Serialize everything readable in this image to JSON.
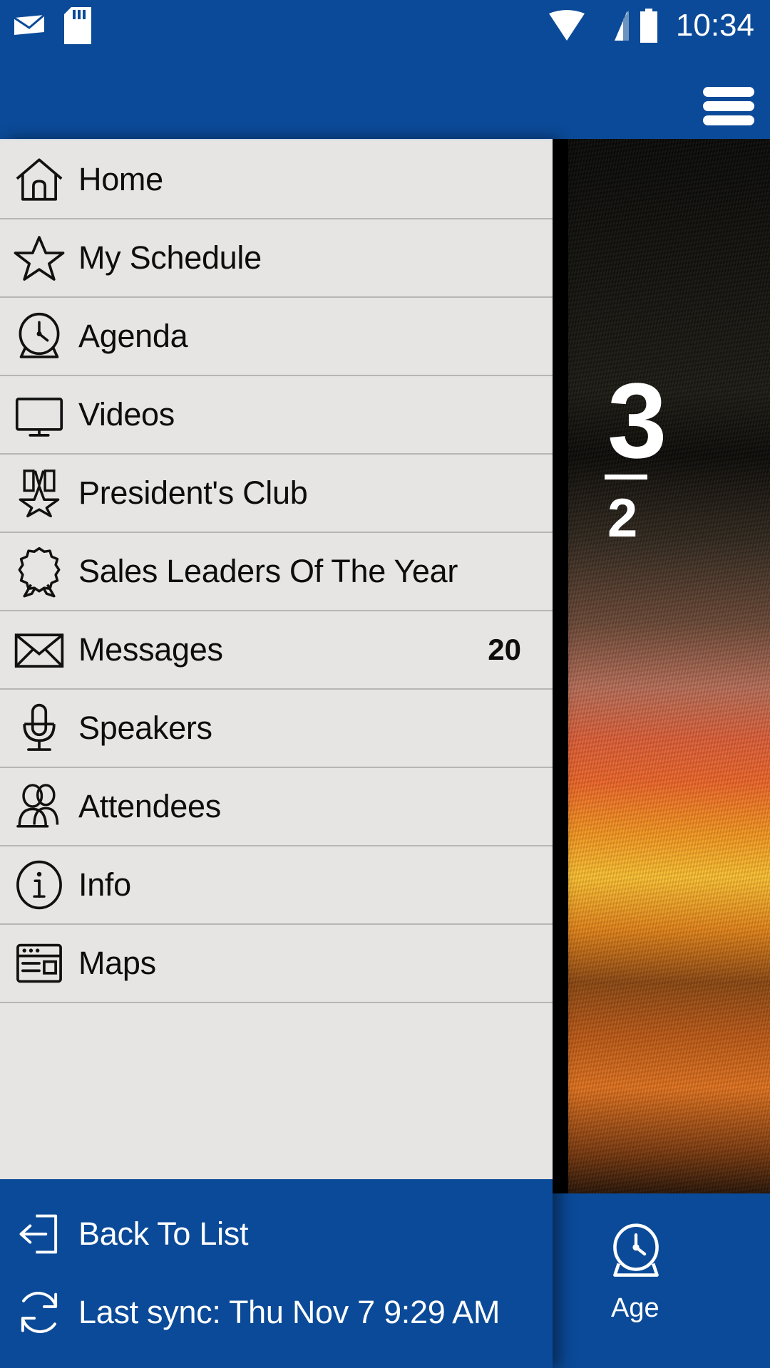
{
  "status_bar": {
    "time": "10:34",
    "icons": [
      "mail-icon",
      "sd-card-icon",
      "wifi-icon",
      "cellular-signal-icon",
      "battery-icon"
    ]
  },
  "app_bar": {
    "menu_icon": "hamburger-menu-icon",
    "background_color": "#0b4a98"
  },
  "background_content": {
    "hero_line_1": "3",
    "hero_line_2": "2",
    "tab_bar": [
      {
        "icon": "clock-icon",
        "label": "Age"
      }
    ]
  },
  "drawer": {
    "background_color": "#e6e5e3",
    "items": [
      {
        "icon": "home-icon",
        "label": "Home",
        "badge": ""
      },
      {
        "icon": "star-icon",
        "label": "My Schedule",
        "badge": ""
      },
      {
        "icon": "clock-icon",
        "label": "Agenda",
        "badge": ""
      },
      {
        "icon": "monitor-icon",
        "label": "Videos",
        "badge": ""
      },
      {
        "icon": "medal-icon",
        "label": "President's Club",
        "badge": ""
      },
      {
        "icon": "award-ribbon-icon",
        "label": "Sales Leaders Of The Year",
        "badge": ""
      },
      {
        "icon": "envelope-icon",
        "label": "Messages",
        "badge": "20"
      },
      {
        "icon": "microphone-icon",
        "label": "Speakers",
        "badge": ""
      },
      {
        "icon": "people-icon",
        "label": "Attendees",
        "badge": ""
      },
      {
        "icon": "info-circle-icon",
        "label": "Info",
        "badge": ""
      },
      {
        "icon": "map-window-icon",
        "label": "Maps",
        "badge": ""
      }
    ],
    "footer": {
      "background_color": "#0b4a98",
      "back_icon": "exit-arrow-icon",
      "back_label": "Back To List",
      "sync_icon": "refresh-sync-icon",
      "sync_label": "Last sync: Thu Nov 7 9:29 AM"
    }
  }
}
